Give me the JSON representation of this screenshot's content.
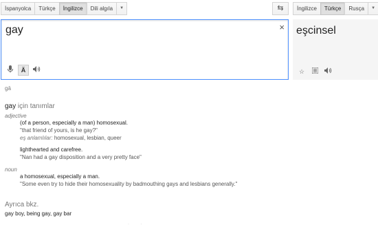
{
  "source_langs": [
    "İspanyolca",
    "Türkçe",
    "İngilizce",
    "Dili algıla"
  ],
  "source_active": 2,
  "target_langs": [
    "İngilizce",
    "Türkçe",
    "Rusça"
  ],
  "target_active": 1,
  "swap_icon": "swap-arrows-icon",
  "source": {
    "text": "gay",
    "clear": "×"
  },
  "target": {
    "text": "eşcinsel"
  },
  "transliteration": "gā",
  "definitions": {
    "term": "gay",
    "heading_suffix": "için tanımlar",
    "adjective": {
      "label": "adjective",
      "sense1": {
        "gloss": "(of a person, especially a man) homosexual.",
        "example": "\"that friend of yours, is he gay?\"",
        "syn_label": "eş anlamlılar:",
        "synonyms": "homosexual, lesbian, queer"
      },
      "sense2": {
        "gloss": "lighthearted and carefree.",
        "example": "\"Nan had a gay disposition and a very pretty face\""
      }
    },
    "noun": {
      "label": "noun",
      "gloss": "a homosexual, especially a man.",
      "example": "\"Some even try to hide their homosexuality by badmouthing gays and lesbians generally.\""
    }
  },
  "see_also": {
    "heading": "Ayrıca bkz.",
    "items": "gay boy, being gay, gay bar"
  }
}
